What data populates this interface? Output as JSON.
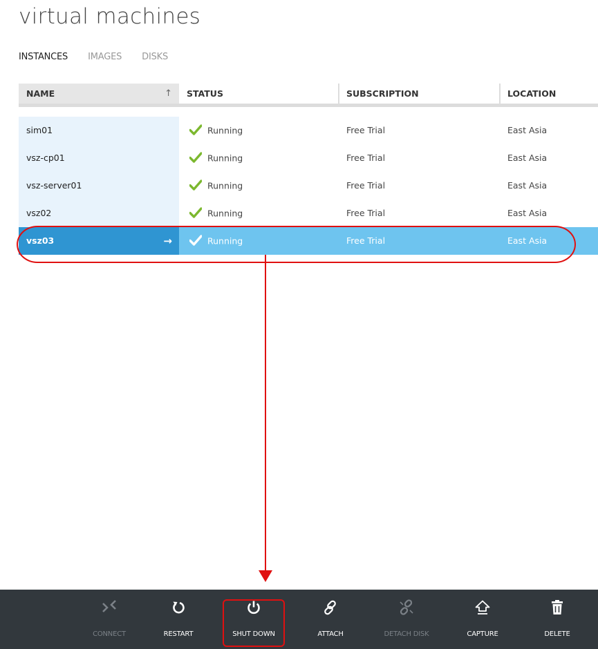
{
  "page": {
    "title": "virtual machines"
  },
  "tabs": [
    {
      "label": "INSTANCES",
      "active": true
    },
    {
      "label": "IMAGES",
      "active": false
    },
    {
      "label": "DISKS",
      "active": false
    }
  ],
  "table": {
    "columns": {
      "name": "NAME",
      "status": "STATUS",
      "subscription": "SUBSCRIPTION",
      "location": "LOCATION"
    },
    "sort_indicator": "↑",
    "rows": [
      {
        "name": "sim01",
        "status": "Running",
        "subscription": "Free Trial",
        "location": "East Asia",
        "selected": false
      },
      {
        "name": "vsz-cp01",
        "status": "Running",
        "subscription": "Free Trial",
        "location": "East Asia",
        "selected": false
      },
      {
        "name": "vsz-server01",
        "status": "Running",
        "subscription": "Free Trial",
        "location": "East Asia",
        "selected": false
      },
      {
        "name": "vsz02",
        "status": "Running",
        "subscription": "Free Trial",
        "location": "East Asia",
        "selected": false
      },
      {
        "name": "vsz03",
        "status": "Running",
        "subscription": "Free Trial",
        "location": "East Asia",
        "selected": true
      }
    ],
    "selected_row_arrow": "→"
  },
  "commands": {
    "connect": {
      "label": "CONNECT",
      "icon": "connect-icon",
      "enabled": false
    },
    "restart": {
      "label": "RESTART",
      "icon": "restart-icon",
      "enabled": true
    },
    "shutdown": {
      "label": "SHUT DOWN",
      "icon": "power-icon",
      "enabled": true
    },
    "attach": {
      "label": "ATTACH",
      "icon": "link-icon",
      "enabled": true
    },
    "detach": {
      "label": "DETACH DISK",
      "icon": "broken-link-icon",
      "enabled": false
    },
    "capture": {
      "label": "CAPTURE",
      "icon": "capture-icon",
      "enabled": true
    },
    "delete": {
      "label": "DELETE",
      "icon": "trash-icon",
      "enabled": true
    }
  },
  "colors": {
    "accent_selected_name": "#2f95d2",
    "accent_selected_row": "#6ec4ef",
    "name_column_bg": "#e8f3fc",
    "status_check": "#7cb82f",
    "command_bar": "#32383d",
    "annotation": "#e01010"
  }
}
